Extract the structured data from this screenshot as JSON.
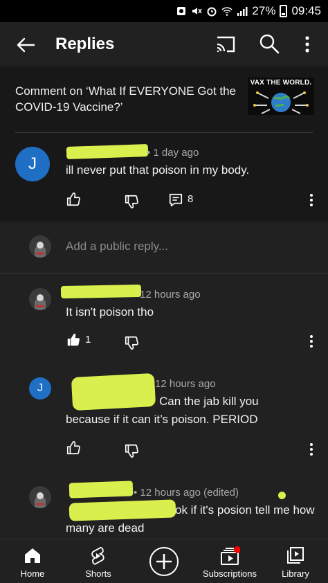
{
  "status_bar": {
    "battery": "27%",
    "time": "09:45"
  },
  "app_bar": {
    "title": "Replies"
  },
  "context": {
    "comment_on": "Comment on ‘What If EVERYONE Got the COVID-19 Vaccine?’",
    "thumbnail_caption": "VAX THE WORLD."
  },
  "parent_comment": {
    "avatar_letter": "J",
    "author_suffix": "• 1 day ago",
    "text": "ill never put that poison in my body.",
    "reply_count": "8"
  },
  "add_reply": {
    "placeholder": "Add a public reply..."
  },
  "replies": [
    {
      "meta": "12 hours ago",
      "text": "It isn't poison tho",
      "likes": "1"
    },
    {
      "avatar_letter": "J",
      "meta": "12 hours ago",
      "text": "Can the jab kill you because if it can it’s poison. PERIOD"
    },
    {
      "meta": "• 12 hours ago (edited)",
      "text": "ok if it's posion tell me how many are dead"
    }
  ],
  "bottom_nav": {
    "home": "Home",
    "shorts": "Shorts",
    "subscriptions": "Subscriptions",
    "library": "Library"
  },
  "colors": {
    "accent_avatar": "#1f6fc5",
    "redaction": "#d9ef4e",
    "notification_dot": "#ff0000"
  }
}
